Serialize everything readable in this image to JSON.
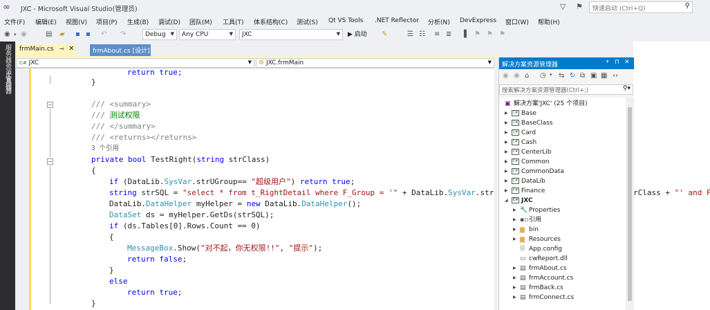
{
  "window": {
    "title": "JXC - Microsoft Visual Studio(管理员)",
    "quick_launch_placeholder": "快速启动 (Ctrl+Q)"
  },
  "menu": [
    "文件(F)",
    "编辑(E)",
    "视图(V)",
    "项目(P)",
    "生成(B)",
    "调试(D)",
    "团队(M)",
    "工具(T)",
    "体系结构(C)",
    "测试(S)",
    "Qt VS Tools",
    ".NET Reflector",
    "分析(N)",
    "DevExpress",
    "窗口(W)",
    "帮助(H)"
  ],
  "toolbar": {
    "config": "Debug",
    "platform": "Any CPU",
    "startup_project": "JXC",
    "start_label": "▶ 启动"
  },
  "left_strip": [
    "服务器资源管理器",
    "工具箱"
  ],
  "tabs": [
    {
      "label": "frmMain.cs"
    },
    {
      "label": "frmAbout.cs [设计]"
    }
  ],
  "nav": {
    "project": "JXC",
    "class": "JXC.frmMain"
  },
  "code": {
    "l1": "return true;",
    "l2": "}",
    "l3a": "/// ",
    "l3b": "<summary>",
    "l4a": "/// ",
    "l4b": "测试权限",
    "l5a": "/// ",
    "l5b": "</summary>",
    "l6a": "/// ",
    "l6b": "<returns></returns>",
    "refs": "3 个引用",
    "l7a": "private bool ",
    "l7b": "TestRight(",
    "l7c": "string ",
    "l7d": "strClass)",
    "l8": "{",
    "l9a": "if ",
    "l9b": "(DataLib.",
    "l9c": "SysVar",
    "l9d": ".strUGroup== ",
    "l9e": "\"超级用户\"",
    "l9f": ") ",
    "l9g": "return true",
    "l9h": ";",
    "l10a": "string ",
    "l10b": "strSQL = ",
    "l10c": "\"select * from t_RightDetail where F_Group = '\"",
    "l10d": " + DataLib.",
    "l10e": "SysVar",
    "l10f": ".strUGr",
    "l11a": "DataLib.",
    "l11b": "DataHelper",
    "l11c": " myHelper = ",
    "l11d": "new ",
    "l11e": "DataLib.",
    "l11f": "DataHelper",
    "l11g": "();",
    "l12a": "DataSet",
    "l12b": " ds = myHelper.GetDs(strSQL);",
    "l13a": "if ",
    "l13b": "(ds.Tables[0].Rows.Count == 0)",
    "l14": "{",
    "l15a": "MessageBox",
    "l15b": ".Show(",
    "l15c": "\"对不起，你无权限!!\"",
    "l15d": ", ",
    "l15e": "\"提示\"",
    "l15f": ");",
    "l16a": "return false",
    "l16b": ";",
    "l17": "}",
    "l18": "else",
    "l19a": "return true",
    "l19b": ";",
    "l20": "}",
    "right_a": "rClass + ",
    "right_b": "\"' and F"
  },
  "solution_explorer": {
    "title": "解决方案资源管理器",
    "search_placeholder": "搜索解决方案资源管理器(Ctrl+;)",
    "root": "解决方案'JXC' (25 个项目)",
    "projects": [
      "Base",
      "BaseClass",
      "Card",
      "Cash",
      "CenterLib",
      "Common",
      "CommonData",
      "DataLib",
      "Finance"
    ],
    "jxc": "JXC",
    "jxc_children": [
      "Properties",
      "引用",
      "bin",
      "Resources",
      "App.config",
      "cwReport.dll",
      "frmAbout.cs",
      "frmAccount.cs",
      "frmBack.cs",
      "frmConnect.cs"
    ]
  }
}
